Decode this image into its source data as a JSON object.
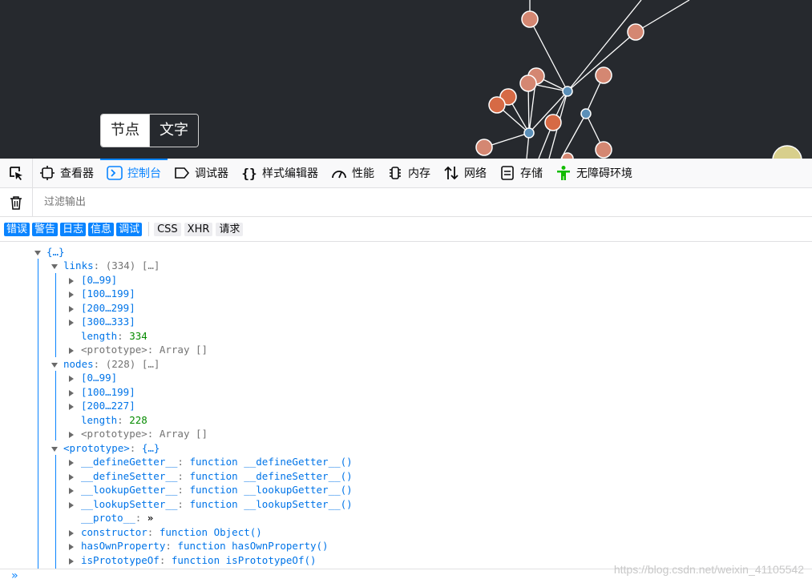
{
  "graph_toggle": {
    "nodes_label": "节点",
    "text_label": "文字"
  },
  "devtools": {
    "tabs": [
      {
        "label": "查看器",
        "icon": "inspector-icon"
      },
      {
        "label": "控制台",
        "icon": "console-icon",
        "active": true
      },
      {
        "label": "调试器",
        "icon": "debugger-icon"
      },
      {
        "label": "样式编辑器",
        "icon": "style-editor-icon"
      },
      {
        "label": "性能",
        "icon": "performance-icon"
      },
      {
        "label": "内存",
        "icon": "memory-icon"
      },
      {
        "label": "网络",
        "icon": "network-icon"
      },
      {
        "label": "存储",
        "icon": "storage-icon"
      },
      {
        "label": "无障碍环境",
        "icon": "accessibility-icon"
      }
    ],
    "accent": "#0a84ff"
  },
  "filter": {
    "placeholder": "过滤输出"
  },
  "levels": {
    "log_levels": [
      "错误",
      "警告",
      "日志",
      "信息",
      "调试"
    ],
    "network": [
      "CSS",
      "XHR",
      "请求"
    ]
  },
  "console": {
    "root": "{…}",
    "links_key": "links",
    "links_summary": "(334) […]",
    "links_items": [
      "[0…99]",
      "[100…199]",
      "[200…299]",
      "[300…333]"
    ],
    "links_length": "334",
    "length_key": "length",
    "prototype_key": "<prototype>",
    "array_proto": "Array []",
    "nodes_key": "nodes",
    "nodes_summary": "(228) […]",
    "nodes_items": [
      "[0…99]",
      "[100…199]",
      "[200…227]"
    ],
    "nodes_length": "228",
    "object_proto": "{…}",
    "proto_members": [
      {
        "key": "__defineGetter__",
        "value": "function __defineGetter__()"
      },
      {
        "key": "__defineSetter__",
        "value": "function __defineSetter__()"
      },
      {
        "key": "__lookupGetter__",
        "value": "function __lookupGetter__()"
      },
      {
        "key": "__lookupSetter__",
        "value": "function __lookupSetter__()"
      }
    ],
    "proto_key": "__proto__",
    "proto_value": "»",
    "proto_members2": [
      {
        "key": "constructor",
        "value": "function Object()"
      },
      {
        "key": "hasOwnProperty",
        "value": "function hasOwnProperty()"
      },
      {
        "key": "isPrototypeOf",
        "value": "function isPrototypeOf()"
      }
    ],
    "prompt": "»"
  },
  "watermark": "https://blog.csdn.net/weixin_41105542",
  "graph_colors": {
    "background": "#26292e",
    "node_salmon": "#d48772",
    "node_orange": "#d66a45",
    "node_blue": "#5b8fb8",
    "node_yellow": "#d8cf8c",
    "edge": "#ffffff"
  }
}
